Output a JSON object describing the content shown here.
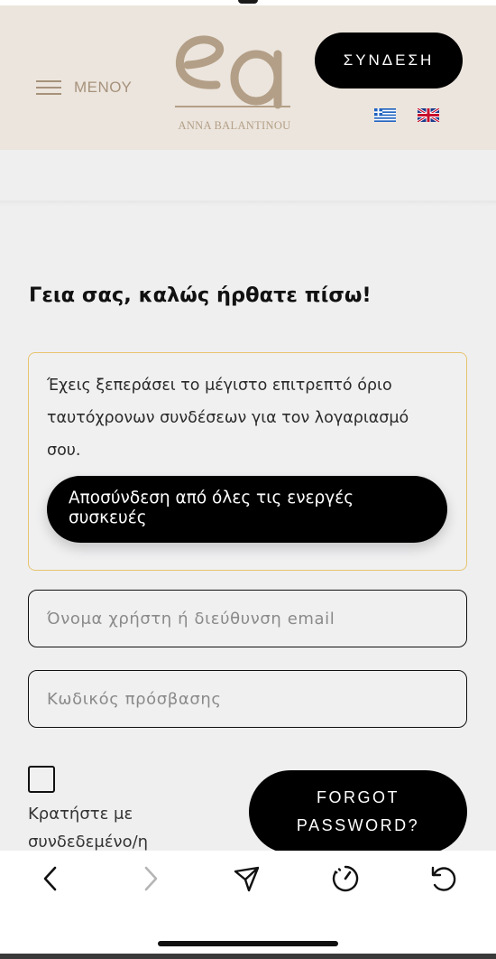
{
  "header": {
    "menu_label": "ΜΕΝΟΥ",
    "logo_monogram": "ea",
    "logo_text": "ANNA BALANTINOU",
    "login_label": "ΣΥΝΔΕΣΗ",
    "languages": [
      "greek-flag-icon",
      "uk-flag-icon"
    ],
    "brand_color": "#a6927c"
  },
  "main": {
    "welcome": "Γεια σας, καλώς ήρθατε πίσω!",
    "notice": {
      "text": "Έχεις ξεπεράσει το μέγιστο επιτρεπτό όριο ταυτόχρονων συνδέσεων για τον λογαριασμό σου.",
      "button_label": "Αποσύνδεση από όλες τις ενεργές συσκευές",
      "border_color": "#e7c46e"
    },
    "username_placeholder": "Όνομα χρήστη ή διεύθυνση email",
    "password_placeholder": "Κωδικός πρόσβασης",
    "remember_label": "Κρατήστε με συνδεδεμένο/η",
    "forgot_line1": "FORGOT",
    "forgot_line2": "PASSWORD?"
  },
  "toolbar": {
    "icons": [
      "back-icon",
      "forward-icon",
      "share-icon",
      "speed-icon",
      "reload-icon"
    ]
  }
}
